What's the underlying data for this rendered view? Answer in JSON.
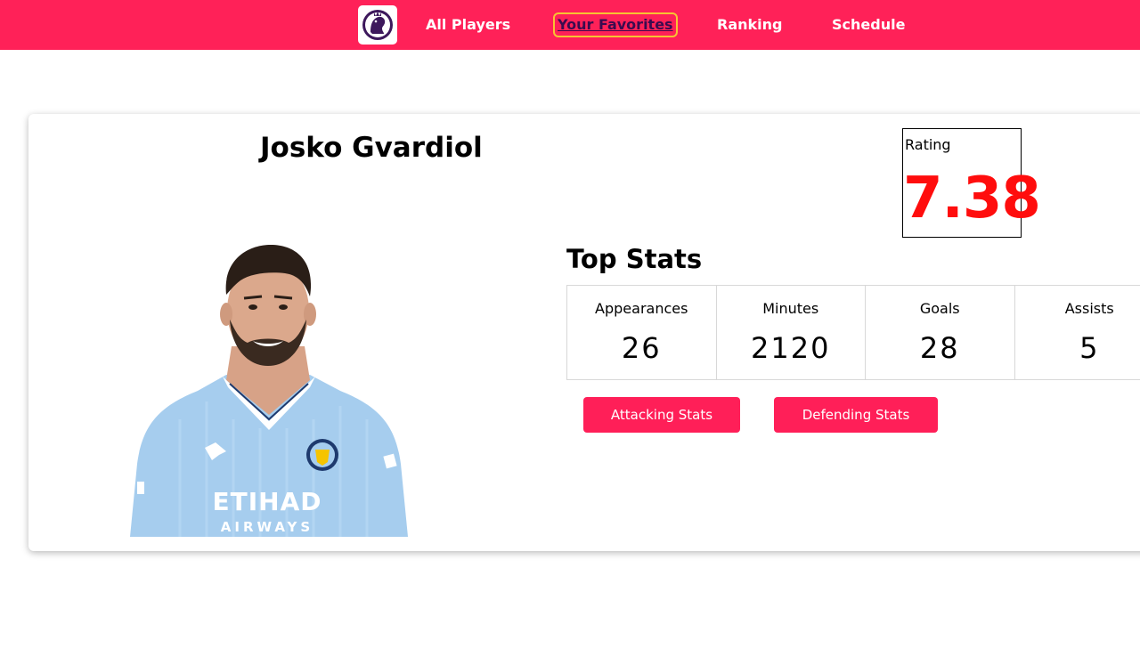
{
  "nav": {
    "logo_icon": "premier-league-lion-icon",
    "links": [
      "All Players",
      "Your Favorites",
      "Ranking",
      "Schedule"
    ],
    "active": "Your Favorites"
  },
  "player": {
    "name": "Josko Gvardiol",
    "photo_icon": "player-photo",
    "shirt_sponsor": "ETIHAD",
    "shirt_sponsor_sub": "AIRWAYS"
  },
  "rating": {
    "label": "Rating",
    "value": "7.38"
  },
  "top_stats": {
    "title": "Top Stats",
    "items": [
      {
        "label": "Appearances",
        "value": "26"
      },
      {
        "label": "Minutes",
        "value": "2120"
      },
      {
        "label": "Goals",
        "value": "28"
      },
      {
        "label": "Assists",
        "value": "5"
      }
    ]
  },
  "buttons": {
    "attacking": "Attacking Stats",
    "defending": "Defending Stats"
  },
  "colors": {
    "brand": "#ff2158",
    "rating": "#ff0d0d",
    "active_link": "#3a0b4f",
    "shirt": "#a6cdee"
  }
}
